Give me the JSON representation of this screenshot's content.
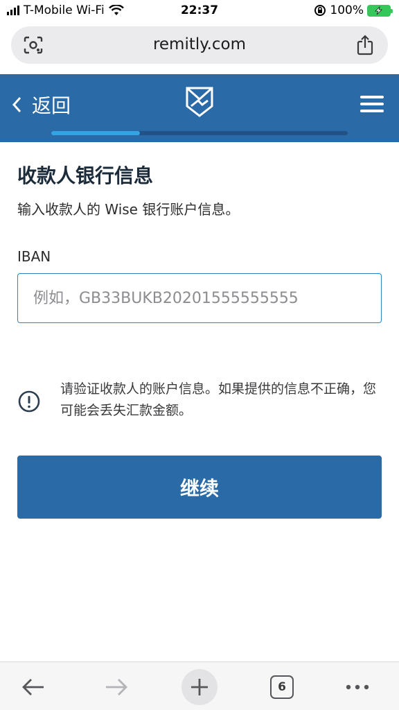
{
  "status_bar": {
    "carrier": "T-Mobile Wi-Fi",
    "time": "22:37",
    "battery": "100%",
    "wifi_icon": "wifi-icon",
    "lock_icon": "orientation-lock-icon"
  },
  "browser": {
    "url": "remitly.com",
    "tab_count": "6",
    "lens_icon": "visual-search-icon",
    "share_icon": "share-icon",
    "back_icon": "arrow-left-icon",
    "forward_icon": "arrow-right-icon",
    "new_tab_icon": "plus-icon",
    "more_icon": "more-icon"
  },
  "header": {
    "back_label": "返回",
    "logo_icon": "remitly-logo-icon",
    "menu_icon": "hamburger-menu-icon",
    "progress_fraction": 0.3
  },
  "main": {
    "title": "收款人银行信息",
    "subtitle": "输入收款人的 Wise 银行账户信息。",
    "iban_label": "IBAN",
    "iban_placeholder": "例如，GB33BUKB20201555555555",
    "iban_value": "",
    "notice": "请验证收款人的账户信息。如果提供的信息不正确，您可能会丢失汇款金额。",
    "notice_icon": "alert-circle-icon",
    "continue_label": "继续"
  },
  "colors": {
    "brand_blue": "#2a6aa6",
    "progress_accent": "#35a2e3",
    "input_border": "#2a84c6"
  }
}
